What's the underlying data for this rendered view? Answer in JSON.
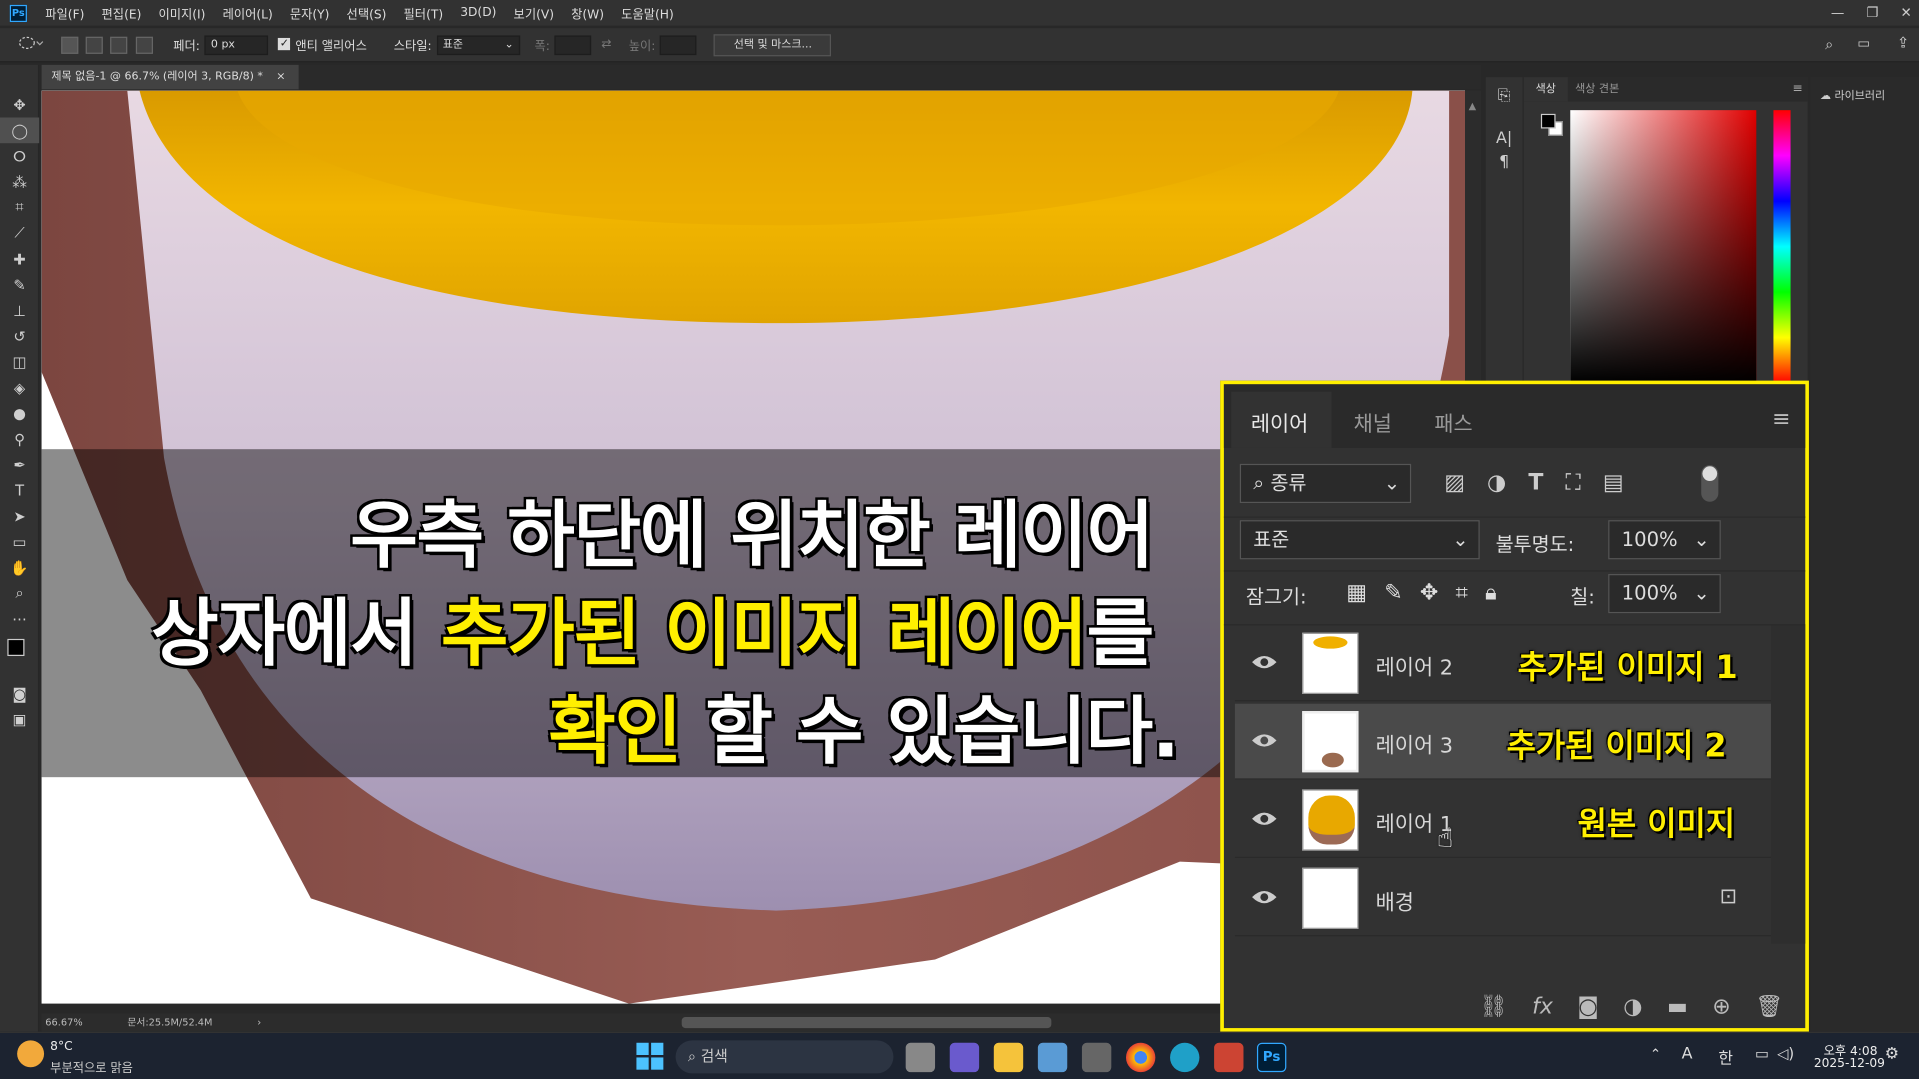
{
  "app": {
    "logo": "Ps",
    "accent": "#31a8ff"
  },
  "menu": [
    "파일(F)",
    "편집(E)",
    "이미지(I)",
    "레이어(L)",
    "문자(Y)",
    "선택(S)",
    "필터(T)",
    "3D(D)",
    "보기(V)",
    "창(W)",
    "도움말(H)"
  ],
  "window_controls": [
    "—",
    "❐",
    "✕"
  ],
  "options": {
    "feather_label": "페더:",
    "feather_value": "0 px",
    "antialias_label": "앤티 앨리어스",
    "style_label": "스타일:",
    "style_value": "표준",
    "width_label": "폭:",
    "height_label": "높이:",
    "select_mask_button": "선택 및 마스크..."
  },
  "document": {
    "tab_title": "제목 없음-1 @ 66.7% (레이어 3, RGB/8) *",
    "zoom": "66.67%",
    "doc_size": "문서:25.5M/52.4M"
  },
  "color_panel": {
    "tab_color": "색상",
    "tab_swatches": "색상 견본"
  },
  "libraries": {
    "label": "라이브러리"
  },
  "layers_panel": {
    "tabs": [
      "레이어",
      "채널",
      "패스"
    ],
    "filter_kind": "종류",
    "blend_mode": "표준",
    "opacity_label": "불투명도:",
    "opacity_value": "100%",
    "lock_label": "잠그기:",
    "fill_label": "칠:",
    "fill_value": "100%",
    "layers": [
      {
        "name": "레이어 2",
        "note": "추가된 이미지 1",
        "selected": false
      },
      {
        "name": "레이어 3",
        "note": "추가된 이미지 2",
        "selected": true
      },
      {
        "name": "레이어 1",
        "note": "원본 이미지",
        "selected": false
      },
      {
        "name": "배경",
        "note": "",
        "selected": false,
        "locked": true
      }
    ]
  },
  "caption": {
    "line1": "우측 하단에 위치한 레이어",
    "line2_a": "상자에서 ",
    "line2_b": "추가된 이미지 레이어",
    "line2_c": "를",
    "line3_a": "확인",
    "line3_b": " 할 수 있습니다."
  },
  "taskbar": {
    "weather_temp": "8°C",
    "weather_desc": "부분적으로 맑음",
    "search_placeholder": "검색",
    "ime_a": "A",
    "ime_han": "한",
    "time": "오후 4:08",
    "date": "2025-12-09"
  },
  "colors": {
    "highlight": "#ffef00",
    "panel": "#323232",
    "background": "#282828"
  }
}
